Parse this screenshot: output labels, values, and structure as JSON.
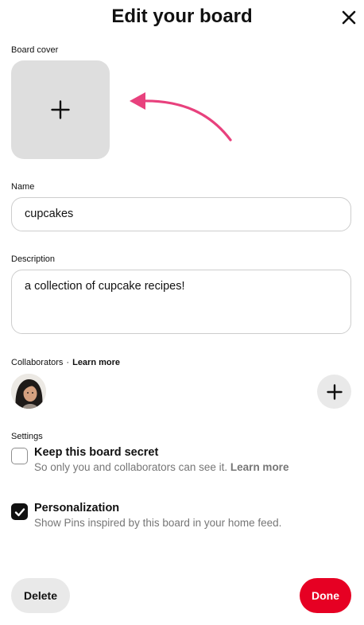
{
  "header": {
    "title": "Edit your board",
    "close_icon": "close-icon"
  },
  "cover": {
    "label": "Board cover",
    "add_icon": "plus-icon",
    "arrow_color": "#e8417d"
  },
  "name": {
    "label": "Name",
    "value": "cupcakes"
  },
  "description": {
    "label": "Description",
    "value": "a collection of cupcake recipes!"
  },
  "collaborators": {
    "label": "Collaborators",
    "separator": "·",
    "learn_more": "Learn more",
    "add_icon": "plus-icon"
  },
  "settings": {
    "label": "Settings",
    "secret": {
      "title": "Keep this board secret",
      "description": "So only you and collaborators can see it.",
      "learn_more": "Learn more",
      "checked": false
    },
    "personalization": {
      "title": "Personalization",
      "description": "Show Pins inspired by this board in your home feed.",
      "checked": true
    }
  },
  "footer": {
    "delete_label": "Delete",
    "done_label": "Done"
  },
  "colors": {
    "accent": "#e60023",
    "secondary_button": "#e9e9e9",
    "cover_placeholder": "#dedede"
  }
}
